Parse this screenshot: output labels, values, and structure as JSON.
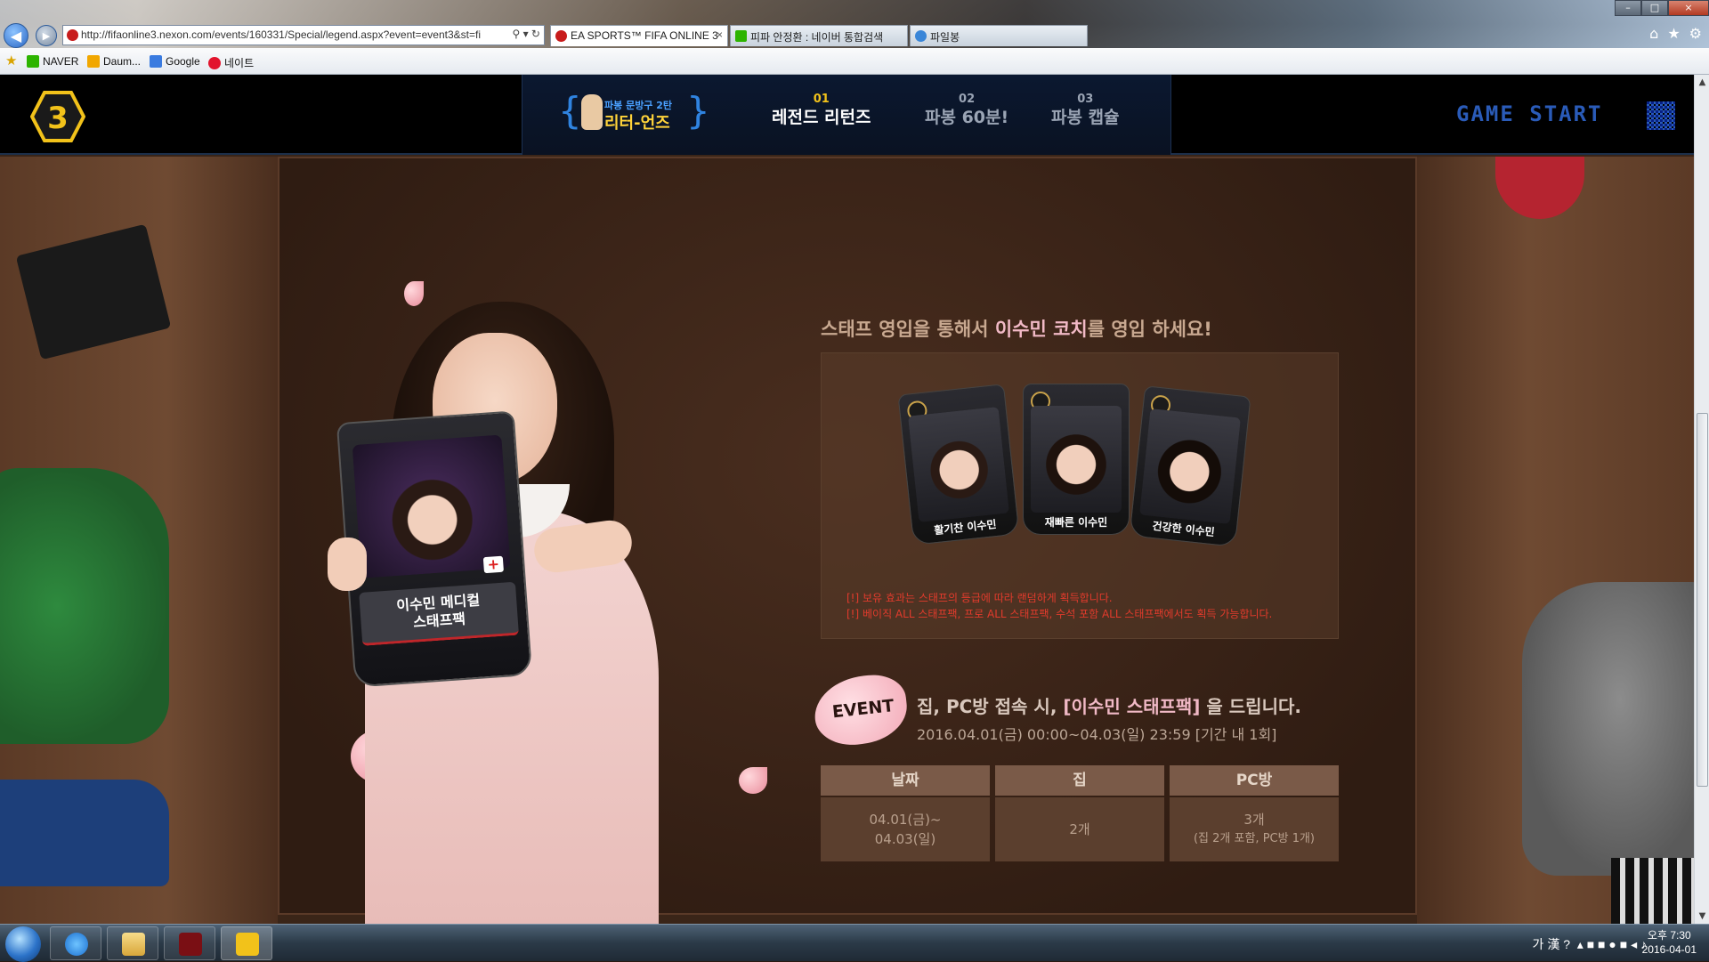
{
  "browser": {
    "url": "http://fifaonline3.nexon.com/events/160331/Special/legend.aspx?event=event3&st=fi",
    "url_controls": "⚲ ▾ ↻",
    "tabs": [
      {
        "label": "EA SPORTS™ FIFA ONLINE 3",
        "close": "×",
        "active": true,
        "color": "#c81c1c"
      },
      {
        "label": "피파 안정환 : 네이버 통합검색",
        "close": "",
        "active": false,
        "color": "#2db400"
      },
      {
        "label": "파일봉",
        "close": "",
        "active": false,
        "color": "#3a86d8"
      }
    ],
    "window_buttons": {
      "minimize": "–",
      "maximize": "□",
      "close": "×"
    },
    "toolbar_icons": [
      "home-icon",
      "star-icon",
      "gear-icon"
    ],
    "toolbar_glyphs": [
      "⌂",
      "★",
      "⚙"
    ]
  },
  "favorites": [
    {
      "label": "NAVER",
      "color": "#2db400"
    },
    {
      "label": "Daum...",
      "color": "#f1a700"
    },
    {
      "label": "Google",
      "color": "#3a7be0"
    },
    {
      "label": "네이트",
      "color": "#e2142d"
    }
  ],
  "site": {
    "logo_text": "3",
    "promo": {
      "sub": "파봉 문방구 2탄",
      "main": "리터-언즈"
    },
    "menu": [
      {
        "num": "01",
        "title": "레전드 리턴즈",
        "active": true
      },
      {
        "num": "02",
        "title": "파봉 60분!",
        "active": false
      },
      {
        "num": "03",
        "title": "파봉 캡슐",
        "active": false
      }
    ],
    "game_start": "GAME START"
  },
  "content": {
    "headline_pre": "스태프 영입을 통해서 ",
    "headline_hl": "이수민 코치",
    "headline_post": "를 영입 하세요!",
    "held_card_label_1": "이수민 메디컬",
    "held_card_label_2": "스태프팩",
    "staff_cards": [
      {
        "name": "활기찬 이수민"
      },
      {
        "name": "재빠른 이수민"
      },
      {
        "name": "건강한 이수민"
      }
    ],
    "notices": [
      "[!] 보유 효과는 스태프의 등급에 따라 랜덤하게 획득합니다.",
      "[!] 베이직 ALL 스태프팩, 프로 ALL 스태프팩, 수석 포함 ALL 스태프팩에서도 획득 가능합니다."
    ],
    "event_badge": "EVENT",
    "event_title_pre": "집, PC방  접속 시, ",
    "event_title_hl": "[이수민 스태프팩]",
    "event_title_post": " 을 드립니다.",
    "event_date": "2016.04.01(금) 00:00~04.03(일) 23:59 [기간 내 1회]",
    "table": {
      "headers": [
        "날짜",
        "집",
        "PC방"
      ],
      "date_line1": "04.01(금)~",
      "date_line2": "04.03(일)",
      "home": "2개",
      "pc_line1": "3개",
      "pc_line2": "(집 2개 포함, PC방 1개)"
    }
  },
  "taskbar": {
    "apps": [
      "ie-icon",
      "folder-icon",
      "flash-icon",
      "fifa3-icon"
    ],
    "tray_text": "가 漢 ?",
    "clock_time": "오후 7:30",
    "clock_date": "2016-04-01"
  }
}
